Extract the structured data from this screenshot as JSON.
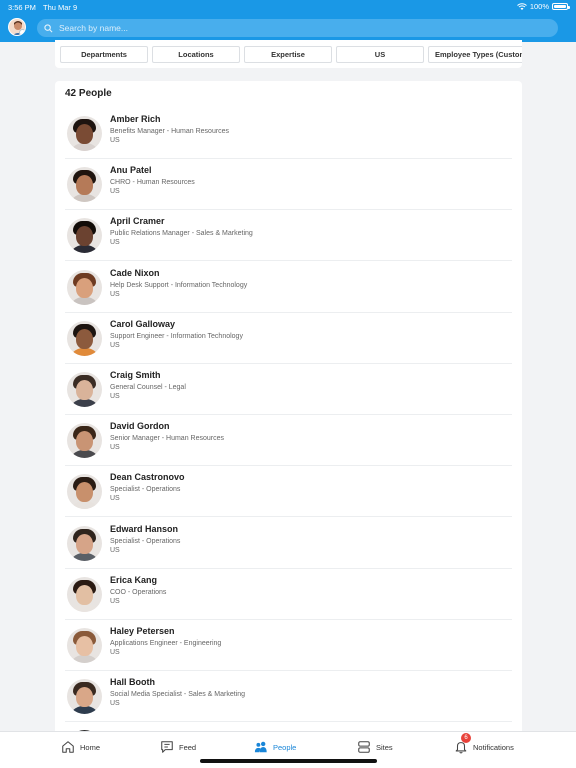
{
  "status": {
    "time": "3:56 PM",
    "date": "Thu Mar 9",
    "battery": "100%"
  },
  "search": {
    "placeholder": "Search by name..."
  },
  "filters": [
    "Departments",
    "Locations",
    "Expertise",
    "US",
    "Employee Types (Custom"
  ],
  "people_count": "42 People",
  "people": [
    {
      "name": "Amber Rich",
      "title": "Benefits Manager - Human Resources",
      "location": "US",
      "skin": "#7a4b34",
      "hair": "#1e1410",
      "shirt": "#d9d2cf"
    },
    {
      "name": "Anu Patel",
      "title": "CHRO - Human Resources",
      "location": "US",
      "skin": "#b57a58",
      "hair": "#1f140e",
      "shirt": "#cfc7c2"
    },
    {
      "name": "April Cramer",
      "title": "Public Relations Manager - Sales & Marketing",
      "location": "US",
      "skin": "#6b4230",
      "hair": "#120c08",
      "shirt": "#2a2b35"
    },
    {
      "name": "Cade Nixon",
      "title": "Help Desk Support - Information Technology",
      "location": "US",
      "skin": "#d9a07c",
      "hair": "#6e3b22",
      "shirt": "#c9c3c0"
    },
    {
      "name": "Carol Galloway",
      "title": "Support Engineer - Information Technology",
      "location": "US",
      "skin": "#8c5a3d",
      "hair": "#1c1410",
      "shirt": "#e08a3a"
    },
    {
      "name": "Craig Smith",
      "title": "General Counsel - Legal",
      "location": "US",
      "skin": "#d9b39a",
      "hair": "#3a2c24",
      "shirt": "#3b3f4a"
    },
    {
      "name": "David Gordon",
      "title": "Senior Manager - Human Resources",
      "location": "US",
      "skin": "#c99474",
      "hair": "#3a2618",
      "shirt": "#4a4a4e"
    },
    {
      "name": "Dean Castronovo",
      "title": "Specialist - Operations",
      "location": "US",
      "skin": "#c8906c",
      "hair": "#2a1c14",
      "shirt": "#e7e2de"
    },
    {
      "name": "Edward Hanson",
      "title": "Specialist - Operations",
      "location": "US",
      "skin": "#d6a488",
      "hair": "#2f241d",
      "shirt": "#5a5f66"
    },
    {
      "name": "Erica Kang",
      "title": "COO - Operations",
      "location": "US",
      "skin": "#e2bfa3",
      "hair": "#2a1a12",
      "shirt": "#e9e4e0"
    },
    {
      "name": "Haley Petersen",
      "title": "Applications Engineer - Engineering",
      "location": "US",
      "skin": "#e7c0a4",
      "hair": "#8a5a3a",
      "shirt": "#d4cfcc"
    },
    {
      "name": "Hall Booth",
      "title": "Social Media Specialist - Sales & Marketing",
      "location": "US",
      "skin": "#d9a788",
      "hair": "#3a2a20",
      "shirt": "#2e3c4e"
    }
  ],
  "tabs": [
    {
      "label": "Home",
      "icon": "home-icon",
      "active": false
    },
    {
      "label": "Feed",
      "icon": "feed-icon",
      "active": false
    },
    {
      "label": "People",
      "icon": "people-icon",
      "active": true
    },
    {
      "label": "Sites",
      "icon": "sites-icon",
      "active": false
    },
    {
      "label": "Notifications",
      "icon": "bell-icon",
      "active": false
    }
  ],
  "notifications_badge": "6",
  "colors": {
    "accent": "#1a98e6",
    "active_tab": "#1a86d8",
    "badge": "#e8423a"
  }
}
